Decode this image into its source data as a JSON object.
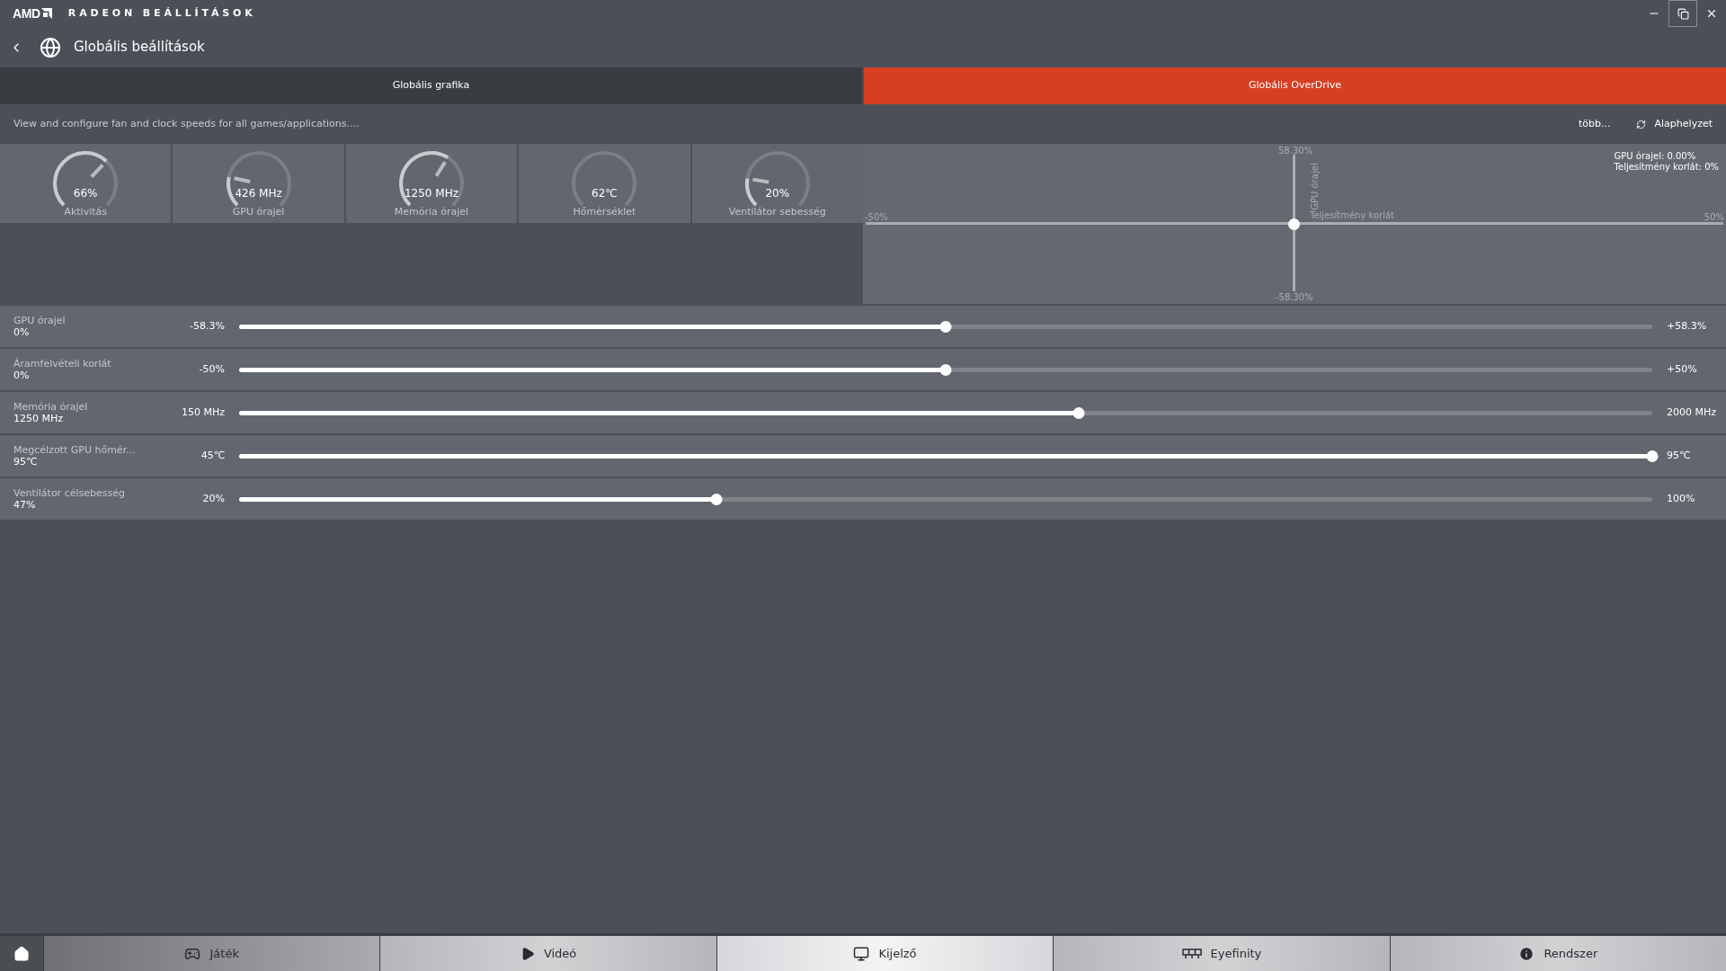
{
  "window": {
    "brand": "AMD",
    "title": "RADEON BEÁLLÍTÁSOK"
  },
  "header": {
    "title": "Globális beállítások"
  },
  "tabs": [
    {
      "label": "Globális grafika",
      "selected": false
    },
    {
      "label": "Globális OverDrive",
      "selected": true
    }
  ],
  "description": "View and configure fan and clock speeds for all games/applications....",
  "more_link": "több...",
  "reset_button": "Alaphelyzet",
  "gauges": [
    {
      "value": "66%",
      "label": "Aktivitás",
      "level": 0.66
    },
    {
      "value": "426 MHz",
      "label": "GPU órajel",
      "level": 0.21
    },
    {
      "value": "1250 MHz",
      "label": "Memória órajel",
      "level": 0.62
    },
    {
      "value": "62℃",
      "label": "Hőmérséklet"
    },
    {
      "value": "20%",
      "label": "Ventilátor sebesség",
      "level": 0.2
    }
  ],
  "tuning_graph": {
    "y_max": "58.30%",
    "y_min": "-58.30%",
    "x_min": "-50%",
    "x_max": "50%",
    "y_axis_label": "GPU órajel",
    "x_axis_label": "Teljesítmény korlát",
    "readouts": [
      "GPU órajel: 0.00%",
      "Teljesítmény korlát: 0%"
    ]
  },
  "sliders": [
    {
      "name": "GPU órajel",
      "value": "0%",
      "min": "-58.3%",
      "max": "+58.3%",
      "level": 0.5
    },
    {
      "name": "Áramfelvételi korlát",
      "value": "0%",
      "min": "-50%",
      "max": "+50%",
      "level": 0.5
    },
    {
      "name": "Memória órajel",
      "value": "1250 MHz",
      "min": "150 MHz",
      "max": "2000 MHz",
      "level": 0.594
    },
    {
      "name": "Megcélzott GPU hőmér...",
      "value": "95℃",
      "min": "45℃",
      "max": "95℃",
      "level": 1
    },
    {
      "name": "Ventilátor célsebesség",
      "value": "47%",
      "min": "20%",
      "max": "100%",
      "level": 0.3375
    }
  ],
  "bottom_nav": [
    {
      "label": "Játék",
      "selected": false
    },
    {
      "label": "Videó",
      "selected": false
    },
    {
      "label": "Kijelző",
      "selected": true
    },
    {
      "label": "Eyefinity",
      "selected": false
    },
    {
      "label": "Rendszer",
      "selected": false
    }
  ]
}
